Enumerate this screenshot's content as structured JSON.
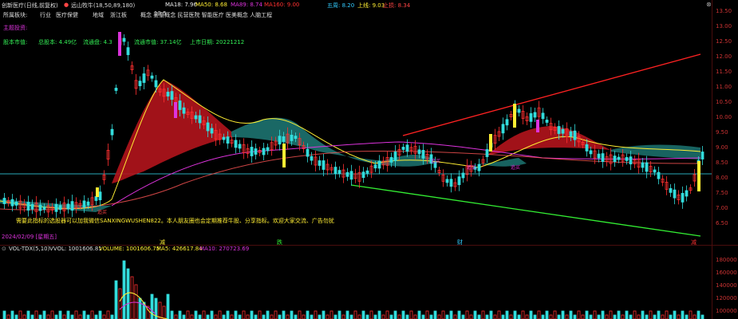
{
  "header": {
    "title": "创新医疗(日线,前复权)",
    "ma_group": "远山牧牛(18,50,89,180)",
    "ma18": "MA18: 7.96",
    "ma50": "MA50: 8.68",
    "ma89": "MA89: 8.74",
    "ma160": "MA160: 9.00",
    "wu": "五周: 8.20",
    "up": "上线: 9.03",
    "stop": "止损: 8.34",
    "close_symbol": "⊗"
  },
  "info": {
    "plates_label": "所属板块:",
    "industry": "行业",
    "industry_value": "医疗保健",
    "region_label": "地域",
    "region_value": "浙江板",
    "concepts": "概念   婴童概念 民营医院 智能医疗 医美概念 人脑工程",
    "main_label": "主题投资:",
    "cap_label": "股本市值:",
    "total_shares": "总股本: 4.49亿",
    "float_shares": "流通盘: 4.3",
    "float_value": "流通市值: 37.14亿",
    "list_date": "上市日期: 20221212",
    "price_peak": "13.5",
    "note": "需要此指标的选股器可以加我微信SANXINGWUSHEN822。本人朋友圈也会定期推荐牛股、分享指标。欢迎大家交流、广告勿扰",
    "bottom_date": "2024/02/09 [星期五]",
    "stage_labels": [
      "减",
      "跌",
      "财",
      "减"
    ],
    "small_labels": [
      "追买",
      "追买",
      "追买",
      "追买"
    ]
  },
  "indicators": {
    "vol_tdx": "VOL-TDX(5,10)",
    "vvol": "VVOL: 1001606.81",
    "volume": "VOLUME: 1001606.75",
    "ma5": "MA5: 426617.84",
    "ma10": "MA10: 270723.69"
  },
  "axis_price": [
    "13.50",
    "13.00",
    "12.50",
    "12.00",
    "11.50",
    "11.00",
    "10.50",
    "10.00",
    "9.50",
    "9.00",
    "8.50",
    "8.00",
    "7.50",
    "7.00",
    "6.50"
  ],
  "axis_vol": [
    "180000",
    "160000",
    "140000",
    "120000",
    "100000"
  ],
  "colors": {
    "up": "#ff3030",
    "down": "#33dddd",
    "red_fill": "#b3141c",
    "teal_fill": "#1b6e6a",
    "magenta": "#dd33dd",
    "yellow": "#ffee33"
  }
}
